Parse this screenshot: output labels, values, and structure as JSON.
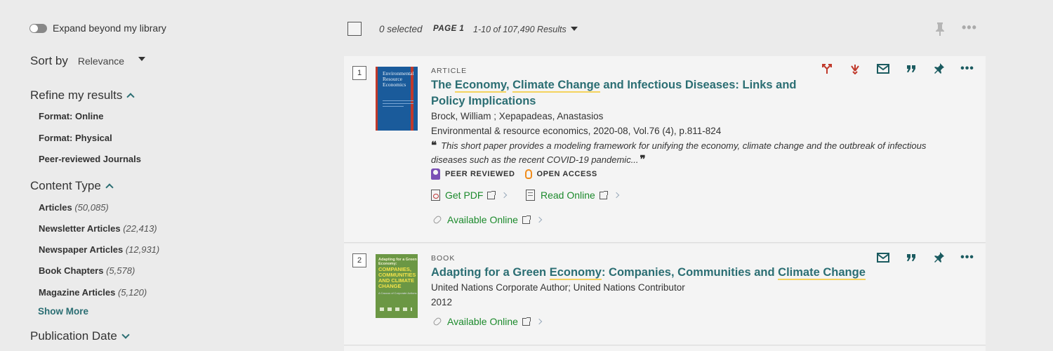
{
  "sidebar": {
    "expand_label": "Expand beyond my library",
    "sort_label": "Sort by",
    "sort_value": "Relevance",
    "refine_title": "Refine my results",
    "refine_items": [
      "Format: Online",
      "Format: Physical",
      "Peer-reviewed Journals"
    ],
    "content_type_title": "Content Type",
    "content_types": [
      {
        "label": "Articles",
        "count": "(50,085)"
      },
      {
        "label": "Newsletter Articles",
        "count": "(22,413)"
      },
      {
        "label": "Newspaper Articles",
        "count": "(12,931)"
      },
      {
        "label": "Book Chapters",
        "count": "(5,578)"
      },
      {
        "label": "Magazine Articles",
        "count": "(5,120)"
      }
    ],
    "show_more": "Show More",
    "pub_date_title": "Publication Date"
  },
  "toolbar": {
    "selected": "0 selected",
    "page": "PAGE 1",
    "results": "1-10 of 107,490 Results"
  },
  "results": [
    {
      "number": "1",
      "type": "ARTICLE",
      "title_parts": [
        "The ",
        "Economy",
        ", ",
        "Climate Change",
        " and Infectious Diseases: Links and Policy Implications"
      ],
      "authors": "Brock, William ; Xepapadeas, Anastasios",
      "source": "Environmental & resource economics, 2020-08, Vol.76 (4), p.811-824",
      "snippet": "This short paper provides a modeling framework for unifying the economy, climate change and the outbreak of infectious diseases such as the recent COVID-19 pandemic...",
      "badge_peer": "PEER REVIEWED",
      "badge_oa": "OPEN ACCESS",
      "get_pdf": "Get PDF",
      "read_online": "Read Online",
      "available": "Available Online",
      "cover_title_lines": [
        "Environmental",
        "Resource",
        "Economics"
      ]
    },
    {
      "number": "2",
      "type": "BOOK",
      "title_parts": [
        "Adapting for a Green ",
        "Economy",
        ": Companies, Communities and ",
        "Climate Change"
      ],
      "authors": "United Nations Corporate Author; United Nations Contributor",
      "year": "2012",
      "available": "Available Online",
      "cover_top": "Adapting for a Green Economy:",
      "cover_main_lines": [
        "COMPANIES,",
        "COMMUNITIES",
        "AND CLIMATE",
        "CHANGE"
      ],
      "cover_sub": "A Caucus of Corporate Actions"
    }
  ],
  "colors": {
    "accent": "#2b6e73",
    "link_green": "#1c8a2c",
    "highlight": "#f4d35e",
    "citation_red": "#c0392b"
  }
}
